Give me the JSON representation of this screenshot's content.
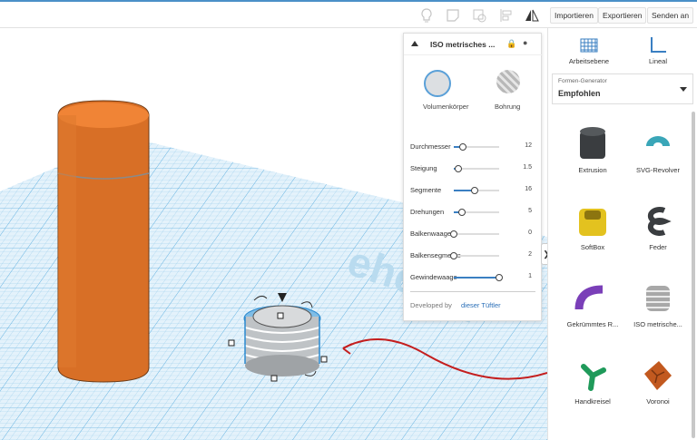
{
  "toolbar": {
    "icons": [
      "lightbulb-icon",
      "note-icon",
      "group-icon",
      "align-icon",
      "mirror-icon"
    ],
    "import_label": "Importieren",
    "export_label": "Exportieren",
    "send_label": "Senden an"
  },
  "properties_panel": {
    "title": "ISO metrisches ...",
    "solid_label": "Volumenkörper",
    "hole_label": "Bohrung",
    "params": [
      {
        "label": "Durchmesser",
        "value": "12",
        "fraction": 0.2
      },
      {
        "label": "Steigung",
        "value": "1.5",
        "fraction": 0.1
      },
      {
        "label": "Segmente",
        "value": "16",
        "fraction": 0.45
      },
      {
        "label": "Drehungen",
        "value": "5",
        "fraction": 0.18
      },
      {
        "label": "Balkenwaage",
        "value": "0",
        "fraction": 0.0
      },
      {
        "label": "Balkensegmente",
        "value": "2",
        "fraction": 0.0
      },
      {
        "label": "Gewindewaage",
        "value": "1",
        "fraction": 1.0
      }
    ],
    "footer_label": "Developed by",
    "footer_link": "dieser Tüftler"
  },
  "sidebar": {
    "workplane_label": "Arbeitsebene",
    "ruler_label": "Lineal",
    "generator_caption": "Formen-Generator",
    "generator_value": "Empfohlen",
    "shapes": [
      {
        "name": "Extrusion",
        "color": "#3a3d40"
      },
      {
        "name": "SVG-Revolver",
        "color": "#3aa6b8"
      },
      {
        "name": "SoftBox",
        "color": "#e3c21f"
      },
      {
        "name": "Feder",
        "color": "#3a3d40"
      },
      {
        "name": "Gekrümmtes R...",
        "color": "#7a3fb8"
      },
      {
        "name": "ISO metrische...",
        "color": "#a8a8a8"
      },
      {
        "name": "Handkreisel",
        "color": "#1f9a5a"
      },
      {
        "name": "Voronoi",
        "color": "#c2591f"
      }
    ]
  },
  "viewport": {
    "cylinder_color": "#e0742a",
    "grid_color": "#8cc6e8",
    "workplane_text": "tinkercad"
  }
}
